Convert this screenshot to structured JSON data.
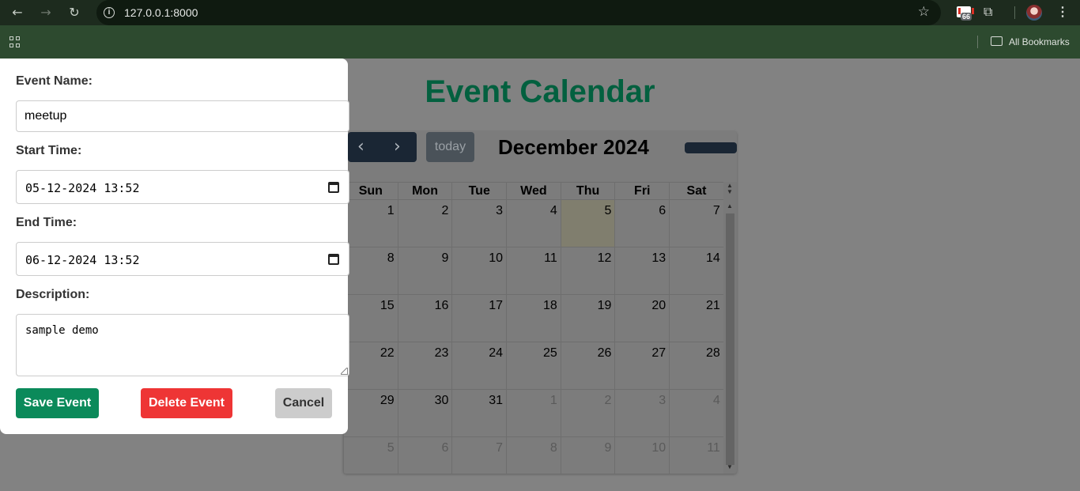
{
  "browser": {
    "url": "127.0.0.1:8000",
    "badge_count": "66",
    "bookmarks_label": "All Bookmarks",
    "icons": [
      "back-icon",
      "forward-icon",
      "reload-icon",
      "info-icon",
      "star-icon",
      "gmail-icon",
      "puzzle-icon",
      "avatar",
      "menu-icon",
      "apps-icon",
      "folder-icon"
    ]
  },
  "page": {
    "title": "Event Calendar",
    "title_color": "#03603f"
  },
  "calendar": {
    "today_label": "today",
    "month_title": "December 2024",
    "weekdays": [
      "Sun",
      "Mon",
      "Tue",
      "Wed",
      "Thu",
      "Fri",
      "Sat"
    ],
    "weeks": [
      [
        {
          "d": "1"
        },
        {
          "d": "2"
        },
        {
          "d": "3"
        },
        {
          "d": "4"
        },
        {
          "d": "5",
          "today": true
        },
        {
          "d": "6"
        },
        {
          "d": "7"
        }
      ],
      [
        {
          "d": "8"
        },
        {
          "d": "9"
        },
        {
          "d": "10"
        },
        {
          "d": "11"
        },
        {
          "d": "12"
        },
        {
          "d": "13"
        },
        {
          "d": "14"
        }
      ],
      [
        {
          "d": "15"
        },
        {
          "d": "16"
        },
        {
          "d": "17"
        },
        {
          "d": "18"
        },
        {
          "d": "19"
        },
        {
          "d": "20"
        },
        {
          "d": "21"
        }
      ],
      [
        {
          "d": "22"
        },
        {
          "d": "23"
        },
        {
          "d": "24"
        },
        {
          "d": "25"
        },
        {
          "d": "26"
        },
        {
          "d": "27"
        },
        {
          "d": "28"
        }
      ],
      [
        {
          "d": "29"
        },
        {
          "d": "30"
        },
        {
          "d": "31"
        },
        {
          "d": "1",
          "muted": true
        },
        {
          "d": "2",
          "muted": true
        },
        {
          "d": "3",
          "muted": true
        },
        {
          "d": "4",
          "muted": true
        }
      ],
      [
        {
          "d": "5",
          "muted": true
        },
        {
          "d": "6",
          "muted": true
        },
        {
          "d": "7",
          "muted": true
        },
        {
          "d": "8",
          "muted": true
        },
        {
          "d": "9",
          "muted": true
        },
        {
          "d": "10",
          "muted": true
        },
        {
          "d": "11",
          "muted": true
        }
      ]
    ]
  },
  "modal": {
    "name_label": "Event Name:",
    "name_value": "meetup",
    "start_label": "Start Time:",
    "start_value": "05-12-2024 13:52",
    "end_label": "End Time:",
    "end_value": "06-12-2024 13:52",
    "desc_label": "Description:",
    "desc_value": "sample demo",
    "save_label": "Save Event",
    "delete_label": "Delete Event",
    "cancel_label": "Cancel",
    "save_color": "#0b8a5a",
    "delete_color": "#ee3535",
    "cancel_color": "#cccccc"
  }
}
